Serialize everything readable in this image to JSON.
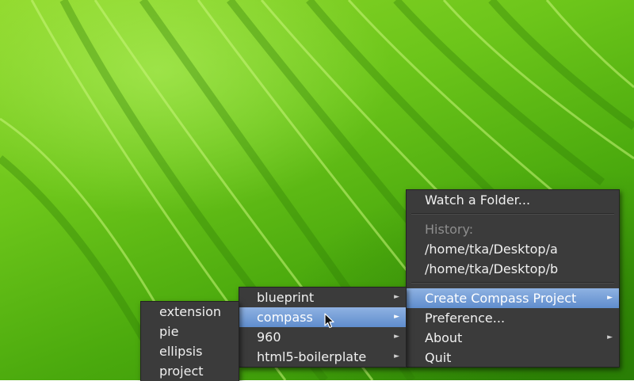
{
  "main_menu": {
    "items": [
      {
        "label": "Watch a Folder..."
      },
      {
        "label": "History:"
      },
      {
        "label": "/home/tka/Desktop/a"
      },
      {
        "label": "/home/tka/Desktop/b"
      },
      {
        "label": "Create Compass Project"
      },
      {
        "label": "Preference..."
      },
      {
        "label": "About"
      },
      {
        "label": "Quit"
      }
    ]
  },
  "framework_menu": {
    "items": [
      {
        "label": "blueprint"
      },
      {
        "label": "compass"
      },
      {
        "label": "960"
      },
      {
        "label": "html5-boilerplate"
      }
    ]
  },
  "pattern_menu": {
    "items": [
      {
        "label": "extension"
      },
      {
        "label": "pie"
      },
      {
        "label": "ellipsis"
      },
      {
        "label": "project"
      }
    ]
  },
  "arrow_glyph": "►",
  "colors": {
    "menu_bg": "#3b3b3b",
    "highlight": "#6f98d4",
    "wallpaper": "#5fb816"
  }
}
